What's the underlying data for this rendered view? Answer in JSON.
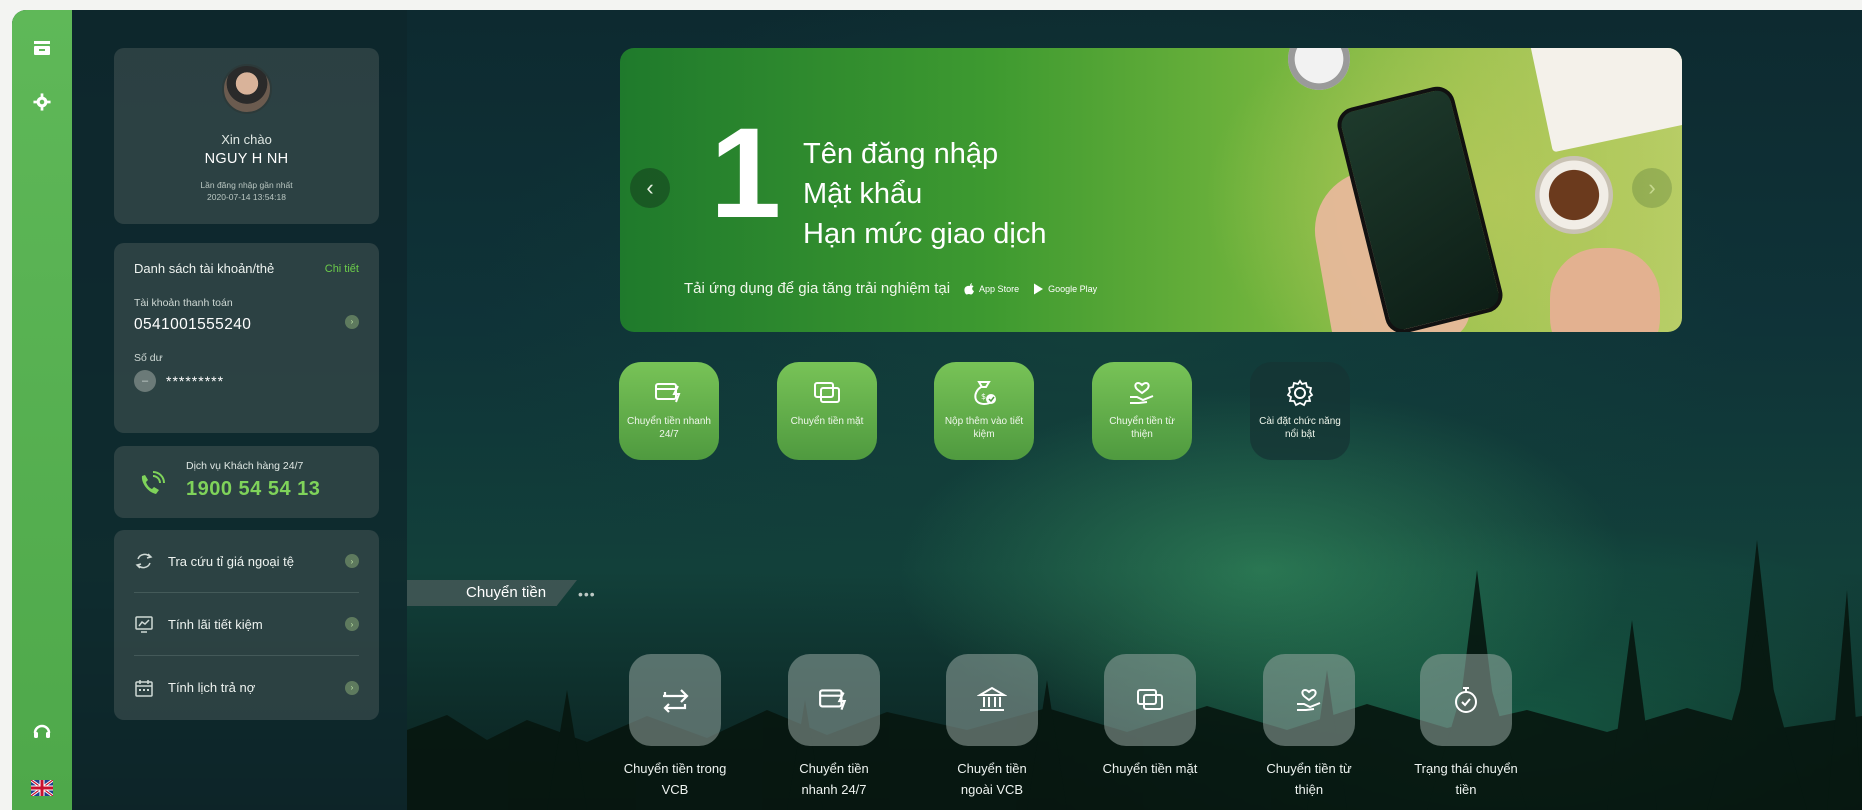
{
  "rail": {
    "icons": [
      "inbox-icon",
      "gear-icon",
      "headset-icon",
      "uk-flag-icon"
    ]
  },
  "profile": {
    "greeting": "Xin chào",
    "name": "NGUY H NH",
    "last_login_label": "Lần đăng nhập gần nhất",
    "last_login_time": "2020-07-14 13:54:18"
  },
  "accounts": {
    "title": "Danh sách tài khoản/thẻ",
    "detail_link": "Chi tiết",
    "account_type": "Tài khoản thanh toán",
    "account_number": "0541001555240",
    "balance_label": "Số dư",
    "balance_masked": "*********"
  },
  "hotline": {
    "label": "Dịch vụ Khách hàng 24/7",
    "number": "1900 54 54 13"
  },
  "tools": [
    {
      "label": "Tra cứu tỉ giá ngoại tệ",
      "icon": "exchange-icon"
    },
    {
      "label": "Tính lãi tiết kiệm",
      "icon": "chart-icon"
    },
    {
      "label": "Tính lịch trả nợ",
      "icon": "calendar-icon"
    }
  ],
  "banner": {
    "big_number": "1",
    "lines": [
      "Tên đăng nhập",
      "Mật khẩu",
      "Hạn mức giao dịch"
    ],
    "footer": "Tải ứng dụng để gia tăng trải nghiệm tại",
    "app_store": "App Store",
    "google_play": "Google Play"
  },
  "quick_actions": [
    {
      "label": "Chuyển tiền nhanh 24/7",
      "icon": "fast-transfer-icon"
    },
    {
      "label": "Chuyển tiền mặt",
      "icon": "cash-transfer-icon"
    },
    {
      "label": "Nộp thêm vào tiết kiệm",
      "icon": "money-bag-icon"
    },
    {
      "label": "Chuyển tiền từ thiện",
      "icon": "charity-icon"
    },
    {
      "label": "Cài đặt chức năng nổi bật",
      "icon": "settings-icon"
    }
  ],
  "section": {
    "title": "Chuyển tiền",
    "more": "•••"
  },
  "transfer_actions": [
    {
      "label": "Chuyển tiền trong VCB",
      "icon": "swap-icon"
    },
    {
      "label": "Chuyển tiền nhanh 24/7",
      "icon": "fast-transfer-icon"
    },
    {
      "label": "Chuyển tiền ngoài VCB",
      "icon": "bank-icon"
    },
    {
      "label": "Chuyển tiền mặt",
      "icon": "cash-transfer-icon"
    },
    {
      "label": "Chuyển tiền từ thiện",
      "icon": "charity-icon"
    },
    {
      "label": "Trạng thái chuyển tiền",
      "icon": "stopwatch-icon"
    }
  ],
  "colors": {
    "accent_green": "#5fb858",
    "hotline_green": "#7fd35a"
  }
}
